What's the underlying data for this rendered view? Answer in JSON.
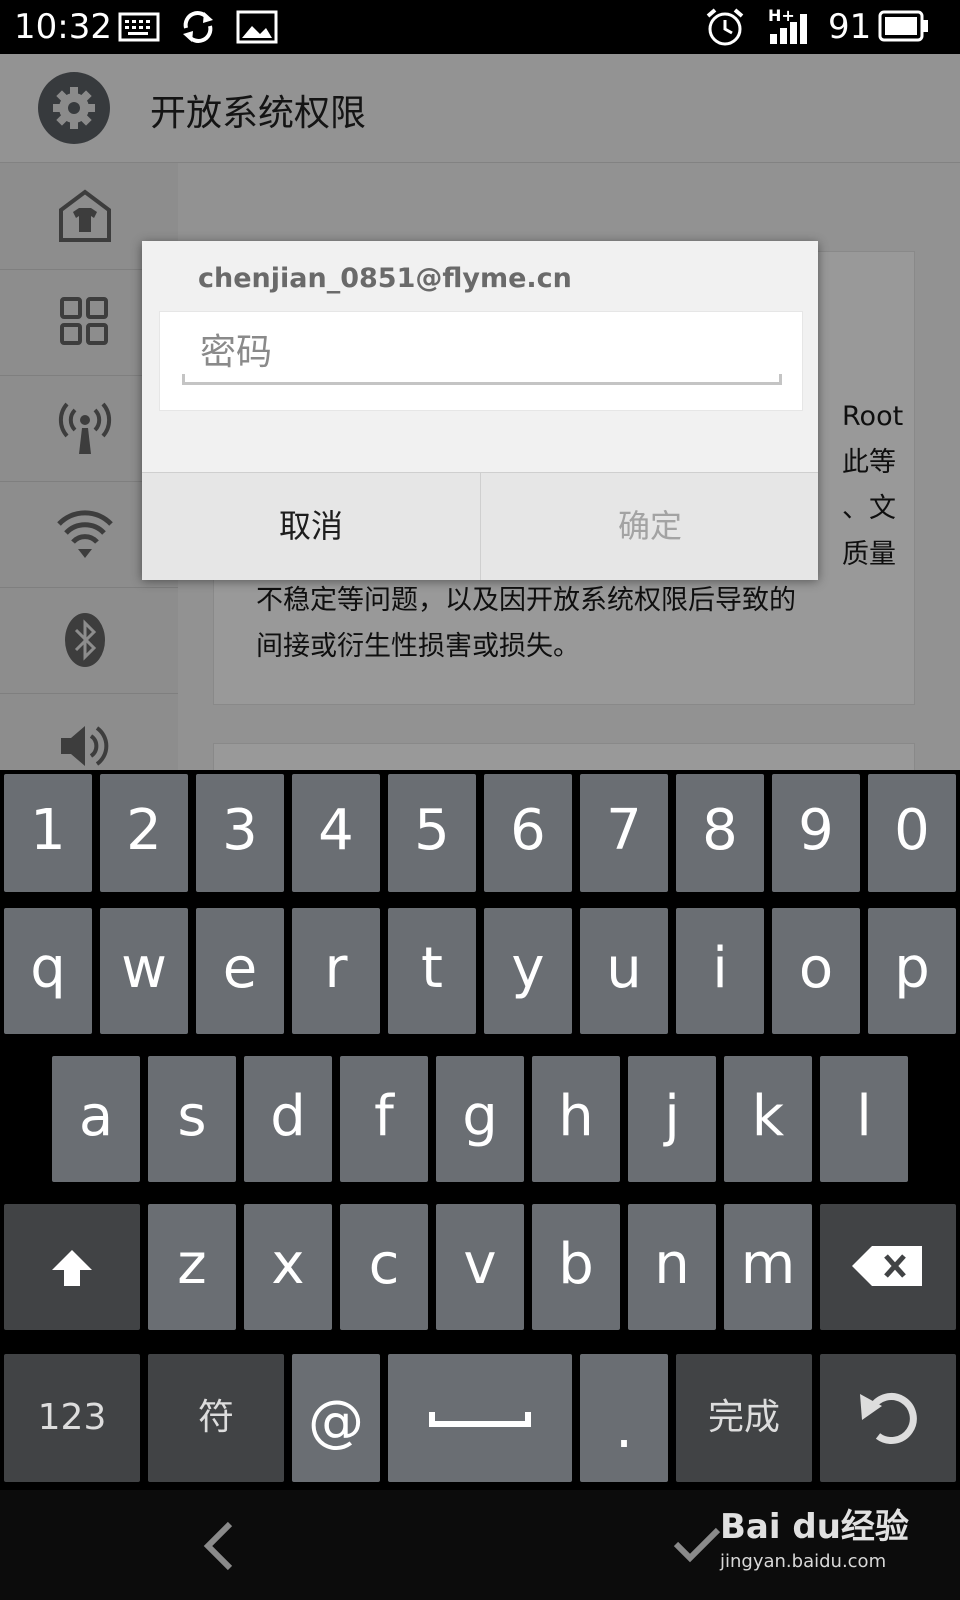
{
  "status_bar": {
    "time": "10:32",
    "battery": "91",
    "network": "H+"
  },
  "header": {
    "title": "开放系统权限"
  },
  "content": {
    "lines": [
      "Root",
      "此等",
      "、文",
      "质量",
      "不稳定等问题，以及因开放系统权限后导致的",
      "间接或衍生性损害或损失。"
    ]
  },
  "dialog": {
    "account": "chenjian_0851@flyme.cn",
    "password_placeholder": "密码",
    "cancel_label": "取消",
    "ok_label": "确定"
  },
  "keyboard": {
    "row_numbers": [
      "1",
      "2",
      "3",
      "4",
      "5",
      "6",
      "7",
      "8",
      "9",
      "0"
    ],
    "row_top": [
      "q",
      "w",
      "e",
      "r",
      "t",
      "y",
      "u",
      "i",
      "o",
      "p"
    ],
    "row_middle": [
      "a",
      "s",
      "d",
      "f",
      "g",
      "h",
      "j",
      "k",
      "l"
    ],
    "row_bottom": [
      "z",
      "x",
      "c",
      "v",
      "b",
      "n",
      "m"
    ],
    "key_123": "123",
    "key_symbols": "符",
    "key_at": "@",
    "key_period": ".",
    "key_done": "完成"
  },
  "watermark": {
    "logo": "Bai du经验",
    "url": "jingyan.baidu.com"
  },
  "icons": [
    "gear-icon",
    "tshirt-home-icon",
    "apps-grid-icon",
    "hotspot-icon",
    "wifi-icon",
    "bluetooth-icon",
    "volume-icon",
    "shift-icon",
    "backspace-icon",
    "undo-icon",
    "back-icon",
    "check-icon",
    "keyboard-icon",
    "sync-icon",
    "image-icon",
    "alarm-icon",
    "signal-icon",
    "battery-icon"
  ]
}
